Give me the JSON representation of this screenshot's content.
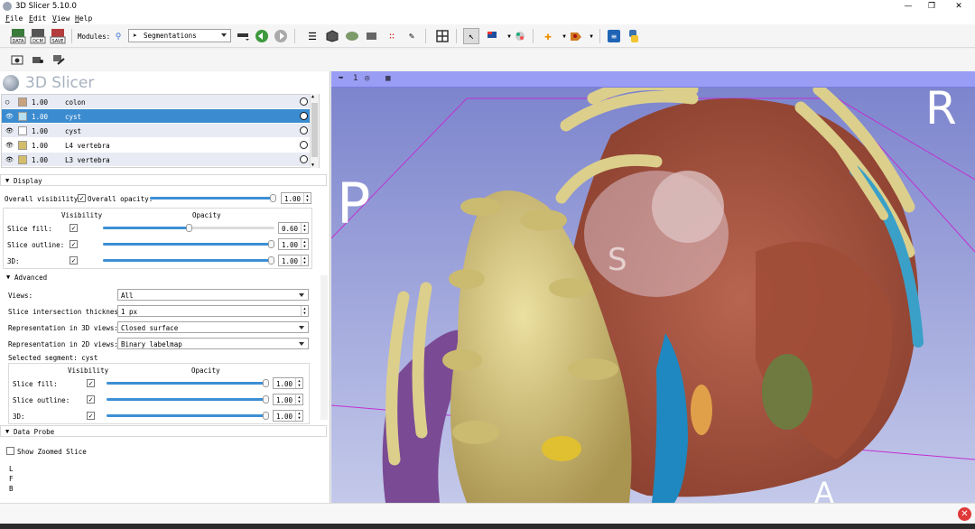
{
  "window": {
    "title": "3D Slicer 5.10.0",
    "min": "—",
    "restore": "❐",
    "close": "✕"
  },
  "menu": [
    "File",
    "Edit",
    "View",
    "Help"
  ],
  "toolbar": {
    "data_btn": "DATA",
    "dcm_btn": "DCM",
    "save_btn": "SAVE",
    "modules_label": "Modules:",
    "modules_value": "Segmentations"
  },
  "logo": {
    "text": "3D Slicer"
  },
  "segments": [
    {
      "opacity": "1.00",
      "name": "colon",
      "color": "#c8a27e",
      "visible": false,
      "selected": false
    },
    {
      "opacity": "1.00",
      "name": "cyst",
      "color": "#b7dfef",
      "visible": true,
      "selected": true
    },
    {
      "opacity": "1.00",
      "name": "cyst",
      "color": "#ffffff",
      "visible": true,
      "selected": false
    },
    {
      "opacity": "1.00",
      "name": "L4 vertebra",
      "color": "#d4bd6a",
      "visible": true,
      "selected": false
    },
    {
      "opacity": "1.00",
      "name": "L3 vertebra",
      "color": "#d4bd6a",
      "visible": true,
      "selected": false
    }
  ],
  "display": {
    "header": "Display",
    "overall_visibility_label": "Overall visibility:",
    "overall_opacity_label": "Overall opacity:",
    "overall_opacity_value": "1.00",
    "overall_opacity_level": 1.0,
    "col_visibility": "Visibility",
    "col_opacity": "Opacity",
    "rows": [
      {
        "label": "Slice fill:",
        "value": "0.60",
        "level": 0.5
      },
      {
        "label": "Slice outline:",
        "value": "1.00",
        "level": 1.0
      },
      {
        "label": "3D:",
        "value": "1.00",
        "level": 1.0
      }
    ]
  },
  "advanced": {
    "header": "Advanced",
    "views_label": "Views:",
    "views_value": "All",
    "thickness_label": "Slice intersection thickness:",
    "thickness_value": "1 px",
    "rep3d_label": "Representation in 3D views:",
    "rep3d_value": "Closed surface",
    "rep2d_label": "Representation in 2D views:",
    "rep2d_value": "Binary labelmap",
    "selected_segment_label": "Selected segment: cyst",
    "col_visibility": "Visibility",
    "col_opacity": "Opacity",
    "rows": [
      {
        "label": "Slice fill:",
        "value": "1.00",
        "level": 1.0
      },
      {
        "label": "Slice outline:",
        "value": "1.00",
        "level": 1.0
      },
      {
        "label": "3D:",
        "value": "1.00",
        "level": 1.0
      }
    ]
  },
  "data_probe": {
    "header": "Data Probe",
    "show_zoomed_label": "Show Zoomed Slice",
    "coords": [
      "L",
      "F",
      "B"
    ]
  },
  "viewer": {
    "view_number": "1",
    "orient_p": "P",
    "orient_r": "R",
    "orient_a": "A",
    "orient_s": "S"
  },
  "status": {
    "close_icon": "✕"
  }
}
